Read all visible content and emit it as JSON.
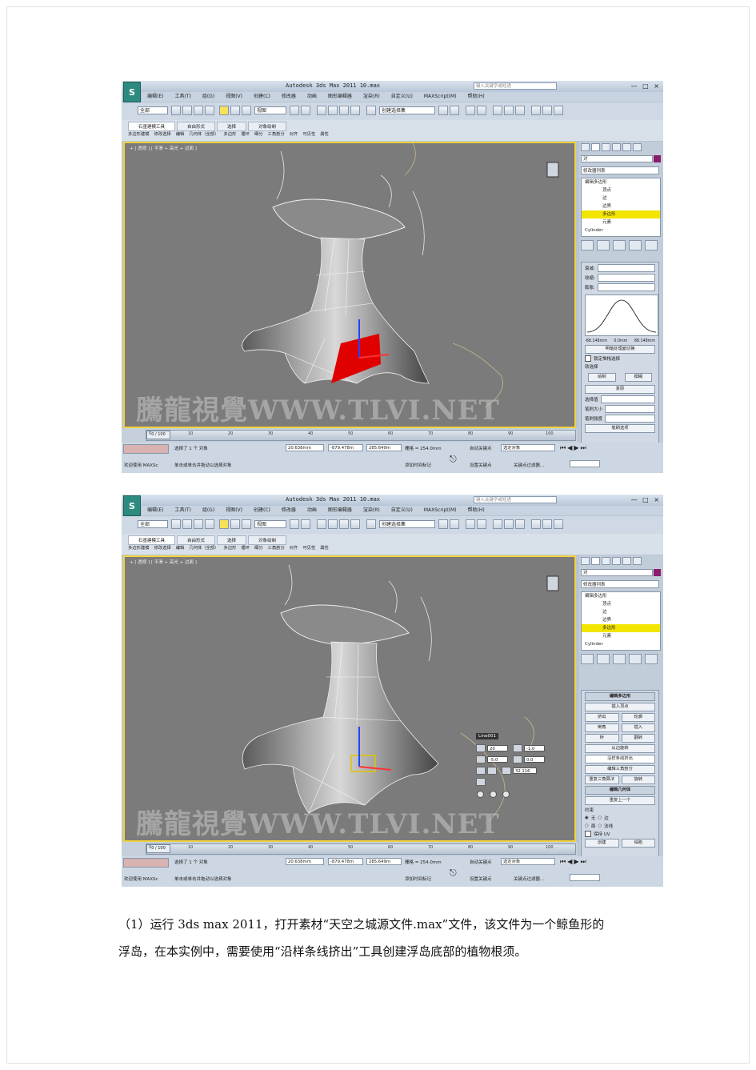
{
  "screenshots": [
    {
      "title": "Autodesk 3ds Max  2011      10.max",
      "search_placeholder": "键入关键字或短语",
      "menus": [
        "编辑(E)",
        "工具(T)",
        "组(G)",
        "视图(V)",
        "创建(C)",
        "修改器",
        "动画",
        "图形编辑器",
        "渲染(R)",
        "自定义(U)",
        "MAXScript(M)",
        "帮助(H)"
      ],
      "toolbar": {
        "filter": "全部",
        "view": "视图",
        "selection_set": "创建选择集"
      },
      "ribbon_tabs": [
        "石墨建模工具",
        "自由形式",
        "选择",
        "对象绘制"
      ],
      "ribbon_sub": [
        "多边形建模",
        "修改选择",
        "编辑",
        "几何体（全部）",
        "多边形",
        "循环",
        "细分",
        "三角剖分",
        "对齐",
        "可见性",
        "属性"
      ],
      "viewport_label": "+ [ 透视 ] [ 平滑 + 高光 + 边面 ]",
      "watermark": "騰龍視覺WWW.TLVI.NET",
      "panel": {
        "object_name": "对",
        "modifier_list": "修改器列表",
        "stack": [
          "编辑多边形",
          "顶点",
          "边",
          "边界",
          "多边形",
          "元素",
          "Cylinder"
        ],
        "stack_selected_index": 4,
        "curve_left": "-88.148mm",
        "curve_mid": "0.0mm",
        "curve_right": "88.148mm",
        "rollout_labels": [
          "衰减:",
          "收缩:",
          "膨胀:",
          "明暗处理面切换",
          "锁定堆栈选择",
          "软选择",
          "绘制",
          "模糊",
          "复原",
          "选择值",
          "笔刷大小",
          "笔刷强度",
          "笔刷选项"
        ]
      },
      "timeline": {
        "frame": "0 / 100",
        "ticks": [
          "0",
          "10",
          "20",
          "30",
          "40",
          "50",
          "60",
          "70",
          "80",
          "90",
          "100"
        ]
      },
      "status": {
        "selected": "选择了 1 个 对象",
        "prompt": "单击或单击并拖动以选择对象",
        "welcome": "欢迎使用 MAXSc",
        "x": "20.638mm",
        "y": "-879.478m",
        "z": "285.649m",
        "grid": "栅格 = 254.0mm",
        "autokey": "自动关键点",
        "selected_obj": "选定对象",
        "setkey": "设置关键点",
        "keyfilter": "关键点过滤器...",
        "add_time_tag": "添加时间标记"
      }
    },
    {
      "title": "Autodesk 3ds Max  2011      10.max",
      "search_placeholder": "键入关键字或短语",
      "menus": [
        "编辑(E)",
        "工具(T)",
        "组(G)",
        "视图(V)",
        "创建(C)",
        "修改器",
        "动画",
        "图形编辑器",
        "渲染(R)",
        "自定义(U)",
        "MAXScript(M)",
        "帮助(H)"
      ],
      "toolbar": {
        "filter": "全部",
        "view": "视图",
        "selection_set": "创建选择集"
      },
      "ribbon_tabs": [
        "石墨建模工具",
        "自由形式",
        "选择",
        "对象绘制"
      ],
      "ribbon_sub": [
        "多边形建模",
        "修改选择",
        "编辑",
        "几何体（全部）",
        "多边形",
        "循环",
        "细分",
        "三角剖分",
        "对齐",
        "可见性",
        "属性"
      ],
      "viewport_label": "+ [ 透视 ] [ 平滑 + 高光 + 边面 ]",
      "watermark": "騰龍視覺WWW.TLVI.NET",
      "caddy": {
        "name": "Line001",
        "segments": "20",
        "taper": "-1.0",
        "taper_curve": "-5.0",
        "twist": "0.0",
        "rotation": "32.116"
      },
      "panel": {
        "object_name": "对",
        "modifier_list": "修改器列表",
        "stack": [
          "编辑多边形",
          "顶点",
          "边",
          "边界",
          "多边形",
          "元素",
          "Cylinder"
        ],
        "stack_selected_index": 4,
        "rollouts": [
          "编辑多边形",
          "插入顶点",
          "挤出",
          "轮廓",
          "倒角",
          "插入",
          "桥",
          "翻转",
          "从边旋转",
          "沿样条线挤出",
          "编辑三角剖分",
          "重复三角算法",
          "旋转",
          "编辑几何体",
          "重复上一个",
          "约束",
          "无",
          "边",
          "面",
          "法线",
          "保持 UV",
          "创建",
          "塌陷"
        ]
      },
      "timeline": {
        "frame": "0 / 100",
        "ticks": [
          "0",
          "10",
          "20",
          "30",
          "40",
          "50",
          "60",
          "70",
          "80",
          "90",
          "100"
        ]
      },
      "status": {
        "selected": "选择了 1 个 对象",
        "prompt": "单击或单击并拖动以选择对象",
        "welcome": "欢迎使用 MAXSc",
        "x": "20.638mm",
        "y": "-879.478m",
        "z": "285.649m",
        "grid": "栅格 = 254.0mm",
        "autokey": "自动关键点",
        "selected_obj": "选定对象",
        "setkey": "设置关键点",
        "keyfilter": "关键点过滤器...",
        "add_time_tag": "添加时间标记"
      }
    }
  ],
  "caption": {
    "line1": "（1）运行 3ds max 2011，打开素材“天空之城源文件.max”文件，该文件为一个鲸鱼形的",
    "line2": "浮岛，在本实例中，需要使用“沿样条线挤出”工具创建浮岛底部的植物根须。"
  },
  "colors": {
    "viewport_border": "#f4d23b",
    "selected_polygon": "#e00000",
    "stack_highlight": "#f2e500"
  }
}
